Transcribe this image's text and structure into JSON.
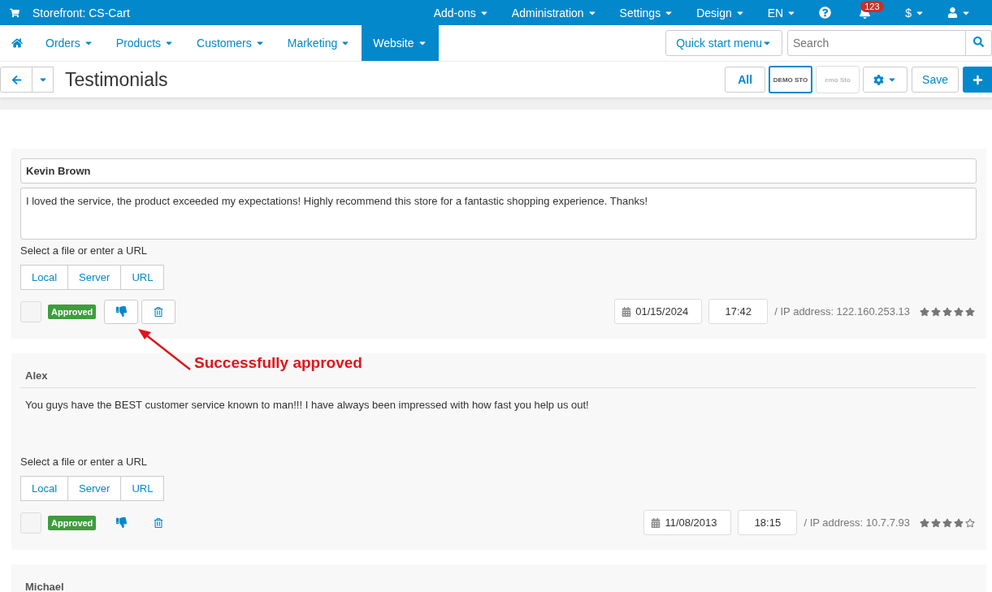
{
  "topbar": {
    "store": "Storefront: CS-Cart",
    "menus": [
      "Add-ons",
      "Administration",
      "Settings",
      "Design",
      "EN"
    ],
    "notifications": "123",
    "currency": "$"
  },
  "nav": {
    "items": [
      {
        "label": "Orders",
        "selected": false
      },
      {
        "label": "Products",
        "selected": false
      },
      {
        "label": "Customers",
        "selected": false
      },
      {
        "label": "Marketing",
        "selected": false
      },
      {
        "label": "Website",
        "selected": true
      }
    ],
    "quick_start": "Quick start menu",
    "search": {
      "placeholder": "Search"
    }
  },
  "toolbar": {
    "title": "Testimonials",
    "all": "All",
    "storefronts": [
      {
        "label": "DEMO STO",
        "selected": true
      },
      {
        "label": "emo Sto",
        "selected": false
      }
    ],
    "save": "Save"
  },
  "testimonials": [
    {
      "name": "Kevin Brown",
      "message": "I loved the service, the product exceeded my expectations! Highly recommend this store for a fantastic shopping experience. Thanks!",
      "active": true,
      "file_label": "Select a file or enter a URL",
      "sources": [
        "Local",
        "Server",
        "URL"
      ],
      "checked": false,
      "status": "Approved",
      "date": "01/15/2024",
      "time": "17:42",
      "ip": "/ IP address: 122.160.253.13",
      "stars": 5
    },
    {
      "name": "Alex",
      "message": "You guys have the BEST customer service known to man!!! I have always been impressed with how fast you help us out!",
      "active": false,
      "file_label": "Select a file or enter a URL",
      "sources": [
        "Local",
        "Server",
        "URL"
      ],
      "checked": false,
      "status": "Approved",
      "date": "11/08/2013",
      "time": "18:15",
      "ip": "/ IP address: 10.7.7.93",
      "stars": 4
    },
    {
      "name": "Michael",
      "active": false
    }
  ],
  "annotation": {
    "text": "Successfully approved"
  }
}
